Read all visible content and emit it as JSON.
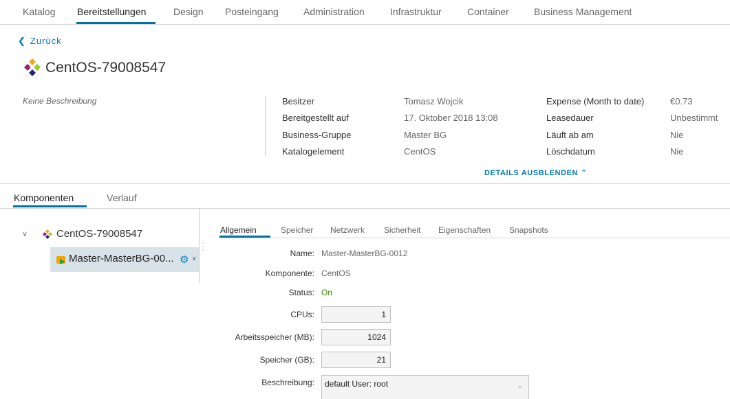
{
  "nav": {
    "tabs": [
      "Katalog",
      "Bereitstellungen",
      "Design",
      "Posteingang",
      "Administration",
      "Infrastruktur",
      "Container",
      "Business Management"
    ],
    "active": "Bereitstellungen"
  },
  "back_label": "Zurück",
  "header": {
    "title": "CentOS-79008547",
    "description": "Keine Beschreibung"
  },
  "details": {
    "owner_label": "Besitzer",
    "owner_value": "Tomasz Wojcik",
    "provisioned_label": "Bereitgestellt auf",
    "provisioned_value": "17. Oktober 2018 13:08",
    "group_label": "Business-Gruppe",
    "group_value": "Master BG",
    "catalog_item_label": "Katalogelement",
    "catalog_item_value": "CentOS",
    "expense_label": "Expense (Month to date)",
    "expense_value": "€0.73",
    "lease_label": "Leasedauer",
    "lease_value": "Unbestimmt",
    "expires_label": "Läuft ab am",
    "expires_value": "Nie",
    "delete_label": "Löschdatum",
    "delete_value": "Nie",
    "toggle_label": "DETAILS AUSBLENDEN"
  },
  "subtabs": [
    "Komponenten",
    "Verlauf"
  ],
  "tree": {
    "root": "CentOS-79008547",
    "child": "Master-MasterBG-00..."
  },
  "detail_tabs": [
    "Allgemein",
    "Speicher",
    "Netzwerk",
    "Sicherheit",
    "Eigenschaften",
    "Snapshots"
  ],
  "general": {
    "name_label": "Name:",
    "name_value": "Master-MasterBG-0012",
    "component_label": "Komponente:",
    "component_value": "CentOS",
    "status_label": "Status:",
    "status_value": "On",
    "cpus_label": "CPUs:",
    "cpus_value": "1",
    "memory_label": "Arbeitsspeicher (MB):",
    "memory_value": "1024",
    "storage_label": "Speicher (GB):",
    "storage_value": "21",
    "description_label": "Beschreibung:",
    "description_value": "default User: root"
  },
  "colors": {
    "accent": "#0072a3",
    "link": "#0079b8",
    "status_on": "#2f8400",
    "selected_row": "#d8e3e9"
  }
}
